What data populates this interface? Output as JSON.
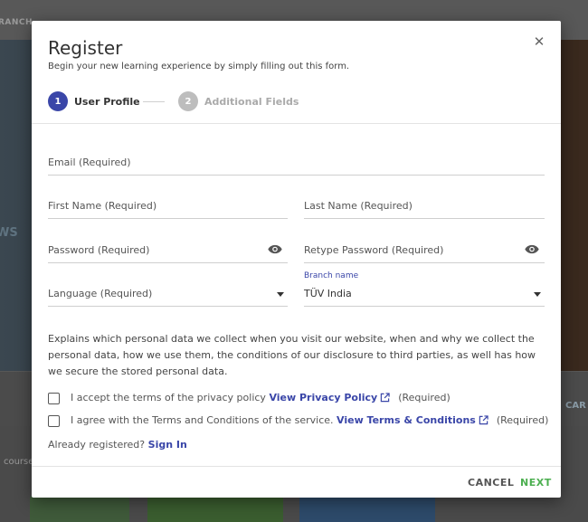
{
  "background": {
    "top_label": "RANCH",
    "hero_text": "WS",
    "strip_right_label": "CAR",
    "courses_label": "l course"
  },
  "modal": {
    "title": "Register",
    "subtitle": "Begin your new learning experience by simply filling out this form.",
    "close_glyph": "✕"
  },
  "stepper": {
    "steps": [
      {
        "number": "1",
        "label": "User Profile",
        "active": true
      },
      {
        "number": "2",
        "label": "Additional Fields",
        "active": false
      }
    ],
    "active_color": "#3a46a8",
    "inactive_color": "#bdbdbd"
  },
  "form": {
    "email": {
      "placeholder": "Email (Required)"
    },
    "first_name": {
      "placeholder": "First Name (Required)"
    },
    "last_name": {
      "placeholder": "Last Name (Required)"
    },
    "password": {
      "placeholder": "Password (Required)",
      "icon": "eye-icon"
    },
    "retype_password": {
      "placeholder": "Retype Password (Required)",
      "icon": "eye-icon"
    },
    "language": {
      "placeholder": "Language (Required)"
    },
    "branch": {
      "label": "Branch name",
      "value": "TÜV India"
    }
  },
  "policy_text": "Explains which personal data we collect when you visit our website, when and why we collect the personal data, how we use them, the conditions of our disclosure to third parties, as well has how we secure the stored personal data.",
  "consents": [
    {
      "text": "I accept the terms of the privacy policy",
      "link": "View Privacy Policy",
      "suffix": "(Required)"
    },
    {
      "text": "I agree with the Terms and Conditions of the service.",
      "link": "View Terms & Conditions",
      "suffix": "(Required)"
    }
  ],
  "signin": {
    "prompt": "Already registered?",
    "link": "Sign In"
  },
  "actions": {
    "cancel": "CANCEL",
    "next": "NEXT"
  },
  "colors": {
    "link": "#3a46a8",
    "next": "#4caf50",
    "cancel": "#555555"
  }
}
